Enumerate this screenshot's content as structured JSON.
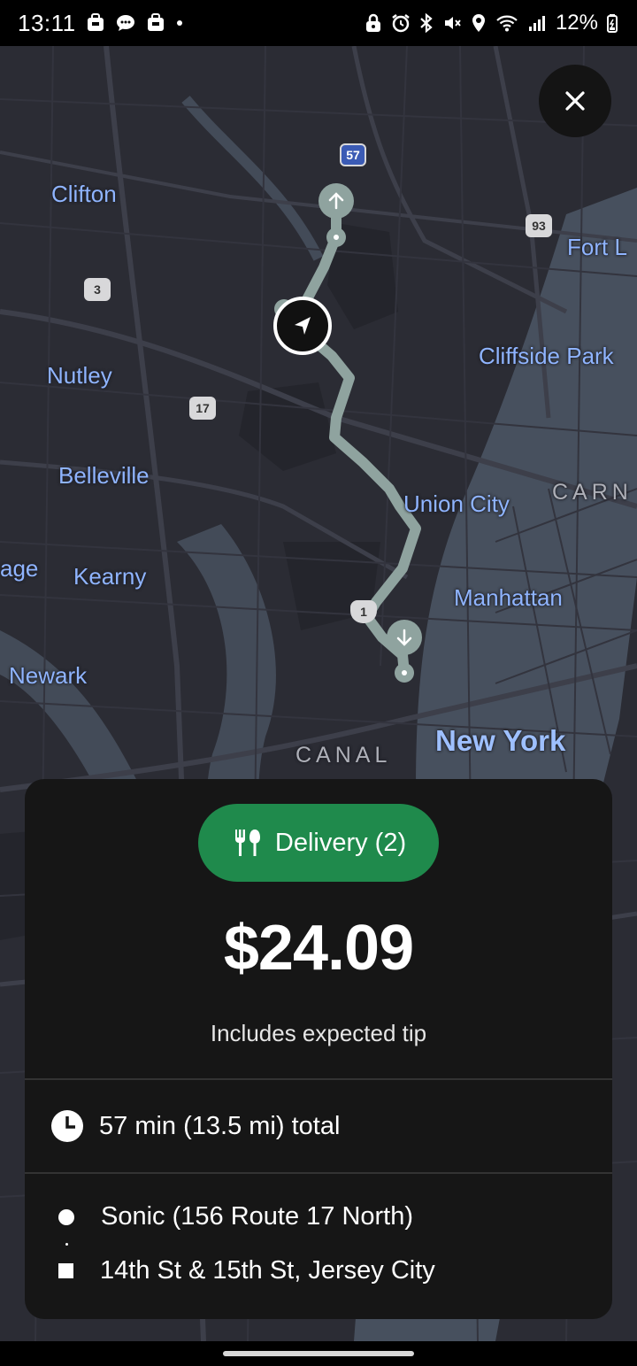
{
  "status_bar": {
    "time": "13:11",
    "battery": "12%",
    "left_icons": [
      "bag-icon",
      "message-icon",
      "bag-icon",
      "dot-icon"
    ],
    "right_icons": [
      "lock-icon",
      "alarm-icon",
      "bluetooth-icon",
      "mute-icon",
      "location-icon",
      "wifi-icon",
      "signal-icon",
      "battery-icon"
    ]
  },
  "map": {
    "labels": {
      "clifton": "Clifton",
      "nutley": "Nutley",
      "belleville": "Belleville",
      "kearny": "Kearny",
      "newark": "Newark",
      "union_city": "Union City",
      "manhattan": "Manhattan",
      "new_york": "New York",
      "cliffside_park": "Cliffside Park",
      "fort_lee": "Fort L",
      "canal": "CANAL",
      "carn": "CARN",
      "age": "age"
    },
    "shields": {
      "route_57": "57",
      "route_3": "3",
      "route_17": "17",
      "route_93": "93",
      "route_1": "1"
    }
  },
  "card": {
    "pill_label": "Delivery (2)",
    "fare": "$24.09",
    "tip_note": "Includes expected tip",
    "trip_summary": "57 min (13.5 mi) total",
    "pickup": "Sonic (156 Route 17 North)",
    "dropoff": "14th St & 15th St, Jersey City"
  },
  "colors": {
    "map_background": "#2b2c34",
    "route": "#8fa39f",
    "pill_green": "#1f8a4c",
    "card_background": "#161616",
    "map_label_blue": "#8fb4ff"
  }
}
